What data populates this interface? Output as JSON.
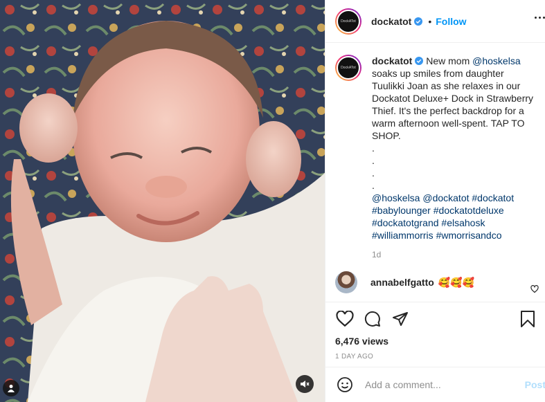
{
  "post": {
    "username": "dockatot",
    "follow_label": "Follow",
    "avatar_text": "DockATot"
  },
  "caption": {
    "username": "dockatot",
    "text_1": "New mom ",
    "mention_1": "@hoskelsa",
    "text_2": " soaks up smiles from daughter Tuulikki Joan as she relaxes in our Dockatot Deluxe+ Dock in Strawberry Thief. It's the perfect backdrop for a warm afternoon well-spent. TAP TO SHOP.",
    "dots": [
      ".",
      ".",
      ".",
      "."
    ],
    "tags": [
      "@hoskelsa",
      "@dockatot",
      "#dockatot",
      "#babylounger",
      "#dockatotdeluxe",
      "#dockatotgrand",
      "#elsahosk",
      "#williammorris",
      "#wmorrisandco"
    ],
    "age": "1d"
  },
  "comments": [
    {
      "username": "annabelfgatto",
      "text": "🥰🥰🥰"
    }
  ],
  "stats": {
    "views": "6,476 views",
    "posted": "1 DAY AGO"
  },
  "add_comment": {
    "placeholder": "Add a comment...",
    "post_label": "Post"
  },
  "icons": {
    "verified": "verified-badge-icon",
    "more": "more-options-icon",
    "like": "heart-icon",
    "comment": "comment-icon",
    "share": "share-icon",
    "save": "bookmark-icon",
    "emoji": "emoji-icon",
    "tag": "user-tag-icon",
    "mute": "muted-speaker-icon"
  },
  "colors": {
    "link": "#00376b",
    "accent": "#0095f6",
    "muted": "#8e8e8e"
  }
}
